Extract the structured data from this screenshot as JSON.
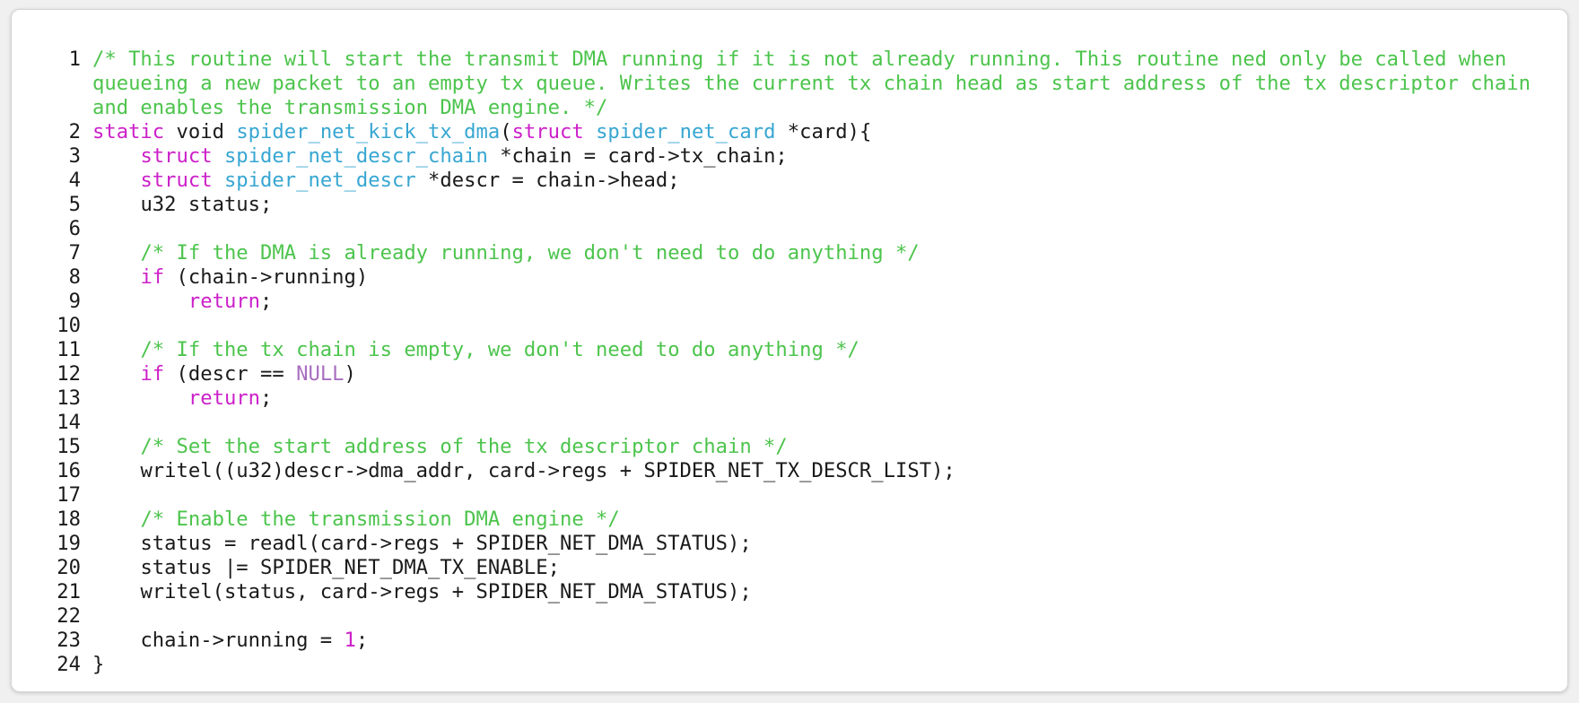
{
  "colors": {
    "comment": "#4cc44c",
    "keyword": "#cc1fc9",
    "function": "#37a6d2",
    "constant": "#a86fc0",
    "text": "#1a1a1a",
    "background": "#ffffff"
  },
  "lines": [
    {
      "n": "1",
      "tokens": [
        {
          "t": "/* This routine will start the transmit DMA running if it is not already running. This routine ned only be called when queueing a new packet to an empty tx queue. Writes the current tx chain head as start address of the tx descriptor chain and enables the transmission DMA engine. */",
          "c": "com"
        }
      ]
    },
    {
      "n": "2",
      "tokens": [
        {
          "t": "static",
          "c": "kw"
        },
        {
          "t": " void ",
          "c": ""
        },
        {
          "t": "spider_net_kick_tx_dma",
          "c": "fn"
        },
        {
          "t": "(",
          "c": ""
        },
        {
          "t": "struct",
          "c": "kw"
        },
        {
          "t": " ",
          "c": ""
        },
        {
          "t": "spider_net_card",
          "c": "fn"
        },
        {
          "t": " *card){",
          "c": ""
        }
      ]
    },
    {
      "n": "3",
      "tokens": [
        {
          "t": "    ",
          "c": ""
        },
        {
          "t": "struct",
          "c": "kw"
        },
        {
          "t": " ",
          "c": ""
        },
        {
          "t": "spider_net_descr_chain",
          "c": "fn"
        },
        {
          "t": " *chain = card->tx_chain;",
          "c": ""
        }
      ]
    },
    {
      "n": "4",
      "tokens": [
        {
          "t": "    ",
          "c": ""
        },
        {
          "t": "struct",
          "c": "kw"
        },
        {
          "t": " ",
          "c": ""
        },
        {
          "t": "spider_net_descr",
          "c": "fn"
        },
        {
          "t": " *descr = chain->head;",
          "c": ""
        }
      ]
    },
    {
      "n": "5",
      "tokens": [
        {
          "t": "    u32 status;",
          "c": ""
        }
      ]
    },
    {
      "n": "6",
      "tokens": [
        {
          "t": " ",
          "c": ""
        }
      ]
    },
    {
      "n": "7",
      "tokens": [
        {
          "t": "    ",
          "c": ""
        },
        {
          "t": "/* If the DMA is already running, we don't need to do anything */",
          "c": "com"
        }
      ]
    },
    {
      "n": "8",
      "tokens": [
        {
          "t": "    ",
          "c": ""
        },
        {
          "t": "if",
          "c": "kw"
        },
        {
          "t": " (chain->running)",
          "c": ""
        }
      ]
    },
    {
      "n": "9",
      "tokens": [
        {
          "t": "        ",
          "c": ""
        },
        {
          "t": "return",
          "c": "kw"
        },
        {
          "t": ";",
          "c": ""
        }
      ]
    },
    {
      "n": "10",
      "tokens": [
        {
          "t": " ",
          "c": ""
        }
      ]
    },
    {
      "n": "11",
      "tokens": [
        {
          "t": "    ",
          "c": ""
        },
        {
          "t": "/* If the tx chain is empty, we don't need to do anything */",
          "c": "com"
        }
      ]
    },
    {
      "n": "12",
      "tokens": [
        {
          "t": "    ",
          "c": ""
        },
        {
          "t": "if",
          "c": "kw"
        },
        {
          "t": " (descr == ",
          "c": ""
        },
        {
          "t": "NULL",
          "c": "const"
        },
        {
          "t": ")",
          "c": ""
        }
      ]
    },
    {
      "n": "13",
      "tokens": [
        {
          "t": "        ",
          "c": ""
        },
        {
          "t": "return",
          "c": "kw"
        },
        {
          "t": ";",
          "c": ""
        }
      ]
    },
    {
      "n": "14",
      "tokens": [
        {
          "t": " ",
          "c": ""
        }
      ]
    },
    {
      "n": "15",
      "tokens": [
        {
          "t": "    ",
          "c": ""
        },
        {
          "t": "/* Set the start address of the tx descriptor chain */",
          "c": "com"
        }
      ]
    },
    {
      "n": "16",
      "tokens": [
        {
          "t": "    writel((u32)descr->dma_addr, card->regs + SPIDER_NET_TX_DESCR_LIST);",
          "c": ""
        }
      ]
    },
    {
      "n": "17",
      "tokens": [
        {
          "t": " ",
          "c": ""
        }
      ]
    },
    {
      "n": "18",
      "tokens": [
        {
          "t": "    ",
          "c": ""
        },
        {
          "t": "/* Enable the transmission DMA engine */",
          "c": "com"
        }
      ]
    },
    {
      "n": "19",
      "tokens": [
        {
          "t": "    status = readl(card->regs + SPIDER_NET_DMA_STATUS);",
          "c": ""
        }
      ]
    },
    {
      "n": "20",
      "tokens": [
        {
          "t": "    status |= SPIDER_NET_DMA_TX_ENABLE;",
          "c": ""
        }
      ]
    },
    {
      "n": "21",
      "tokens": [
        {
          "t": "    writel(status, card->regs + SPIDER_NET_DMA_STATUS);",
          "c": ""
        }
      ]
    },
    {
      "n": "22",
      "tokens": [
        {
          "t": " ",
          "c": ""
        }
      ]
    },
    {
      "n": "23",
      "tokens": [
        {
          "t": "    chain->running = ",
          "c": ""
        },
        {
          "t": "1",
          "c": "num"
        },
        {
          "t": ";",
          "c": ""
        }
      ]
    },
    {
      "n": "24",
      "tokens": [
        {
          "t": "}",
          "c": ""
        }
      ]
    }
  ]
}
